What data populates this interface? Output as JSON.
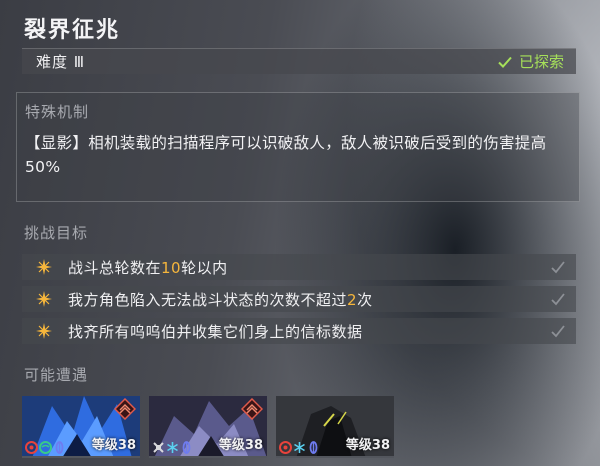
{
  "title": "裂界征兆",
  "difficulty": {
    "label": "难度 Ⅲ",
    "status": "已探索"
  },
  "mechanism": {
    "heading": "特殊机制",
    "text": "【显影】相机装载的扫描程序可以识破敌人，敌人被识破后受到的伤害提高50%"
  },
  "challenge": {
    "heading": "挑战目标",
    "goals": [
      {
        "pre": "战斗总轮数在",
        "hl": "10",
        "post": "轮以内"
      },
      {
        "pre": "我方角色陷入无法战斗状态的次数不超过",
        "hl": "2",
        "post": "次"
      },
      {
        "pre": "找齐所有呜呜伯并收集它们身上的信标数据",
        "hl": "",
        "post": ""
      }
    ]
  },
  "enemies": {
    "heading": "可能遭遇",
    "items": [
      {
        "level": "等级38",
        "icons": [
          "fire-weakness-icon",
          "wind-weakness-icon",
          "imaginary-weakness-icon"
        ],
        "elite": true
      },
      {
        "level": "等级38",
        "icons": [
          "physical-weakness-icon",
          "ice-weakness-icon",
          "imaginary-weakness-icon"
        ],
        "elite": true
      },
      {
        "level": "等级38",
        "icons": [
          "fire-weakness-icon",
          "ice-weakness-icon",
          "imaginary-weakness-icon"
        ],
        "elite": false
      }
    ]
  },
  "colors": {
    "accent_green": "#a6e05a",
    "highlight_orange": "#f6b63c"
  }
}
